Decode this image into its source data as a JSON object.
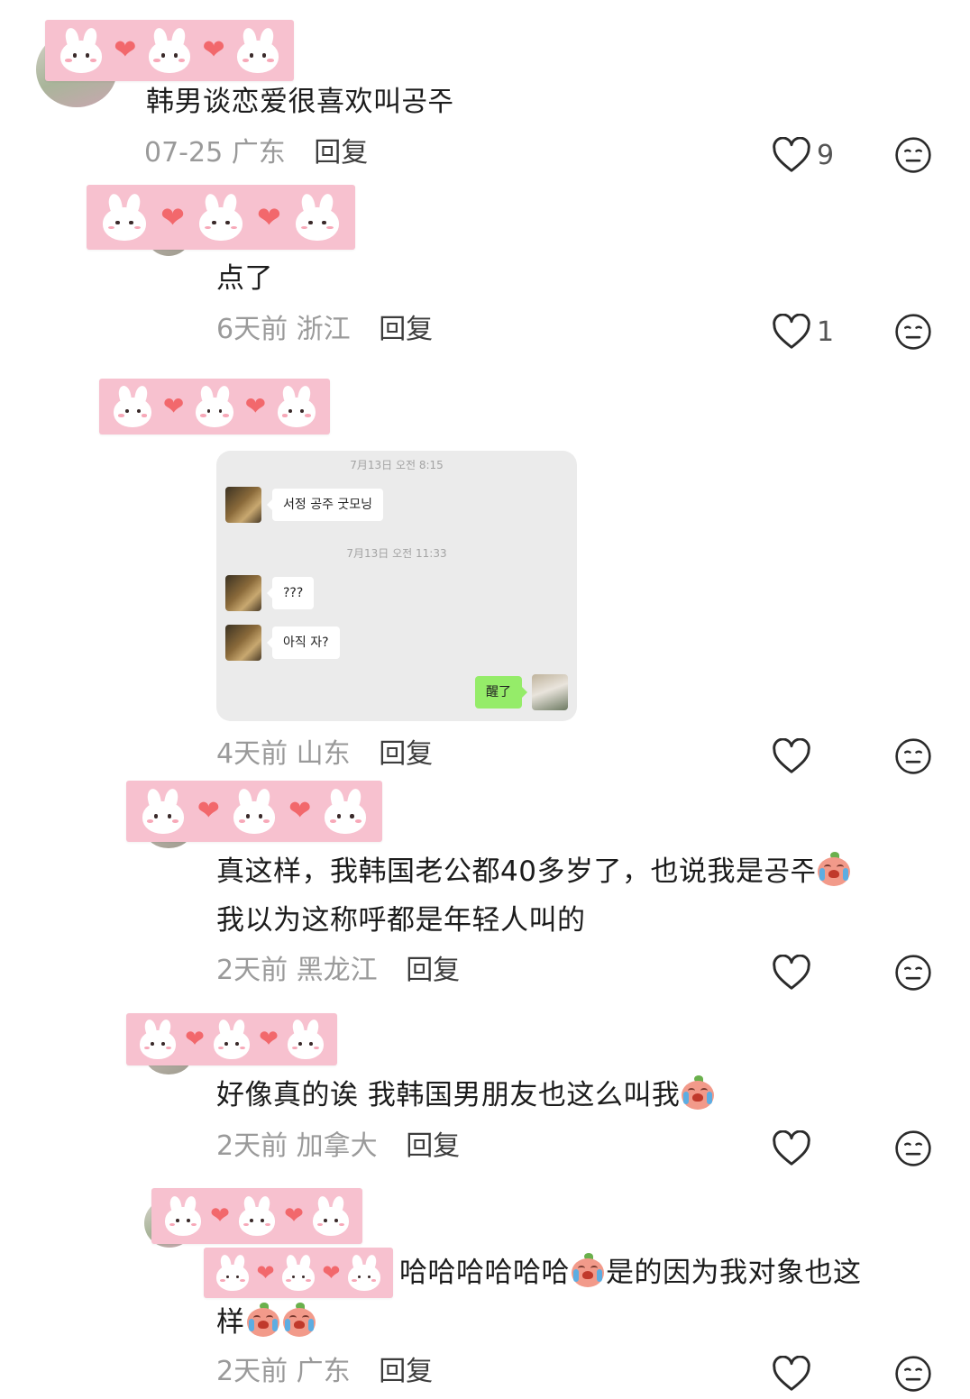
{
  "comments": [
    {
      "text": "韩男谈恋爱很喜欢叫공주",
      "time": "07-25",
      "location": "广东",
      "reply": "回复",
      "likes": "9"
    },
    {
      "text": "点了",
      "time": "6天前",
      "location": "浙江",
      "reply": "回复",
      "likes": "1"
    },
    {
      "time": "4天前",
      "location": "山东",
      "reply": "回复",
      "likes": "",
      "chat_image": {
        "timestamp_1": "7月13日 오전 8:15",
        "msg_1": "서정 공주 굿모닝",
        "timestamp_2": "7月13日 오전 11:33",
        "msg_2": "???",
        "msg_3": "아직 자?",
        "msg_4": "醒了"
      }
    },
    {
      "text_line1": "真这样，我韩国老公都40多岁了，也说我是공주",
      "text_line2": "我以为这称呼都是年轻人叫的",
      "time": "2天前",
      "location": "黑龙江",
      "reply": "回复",
      "likes": ""
    },
    {
      "text": "好像真的诶 我韩国男朋友也这么叫我",
      "time": "2天前",
      "location": "加拿大",
      "reply": "回复",
      "likes": ""
    },
    {
      "text_a": "哈哈哈哈哈哈",
      "text_b": "是的因为我对象也这",
      "text_c": "样",
      "time": "2天前",
      "location": "广东",
      "reply": "回复",
      "likes": ""
    }
  ],
  "icons": {
    "like": "heart-outline-icon",
    "dislike": "neutral-face-icon",
    "emoji": "crying-peach-emoji",
    "sticker": "bunny-heart-sticker"
  },
  "colors": {
    "sticker_pink": "#f7c1cf",
    "heart_red": "#f2686c",
    "meta_gray": "#9a9a9a",
    "chat_green": "#95ec69"
  }
}
